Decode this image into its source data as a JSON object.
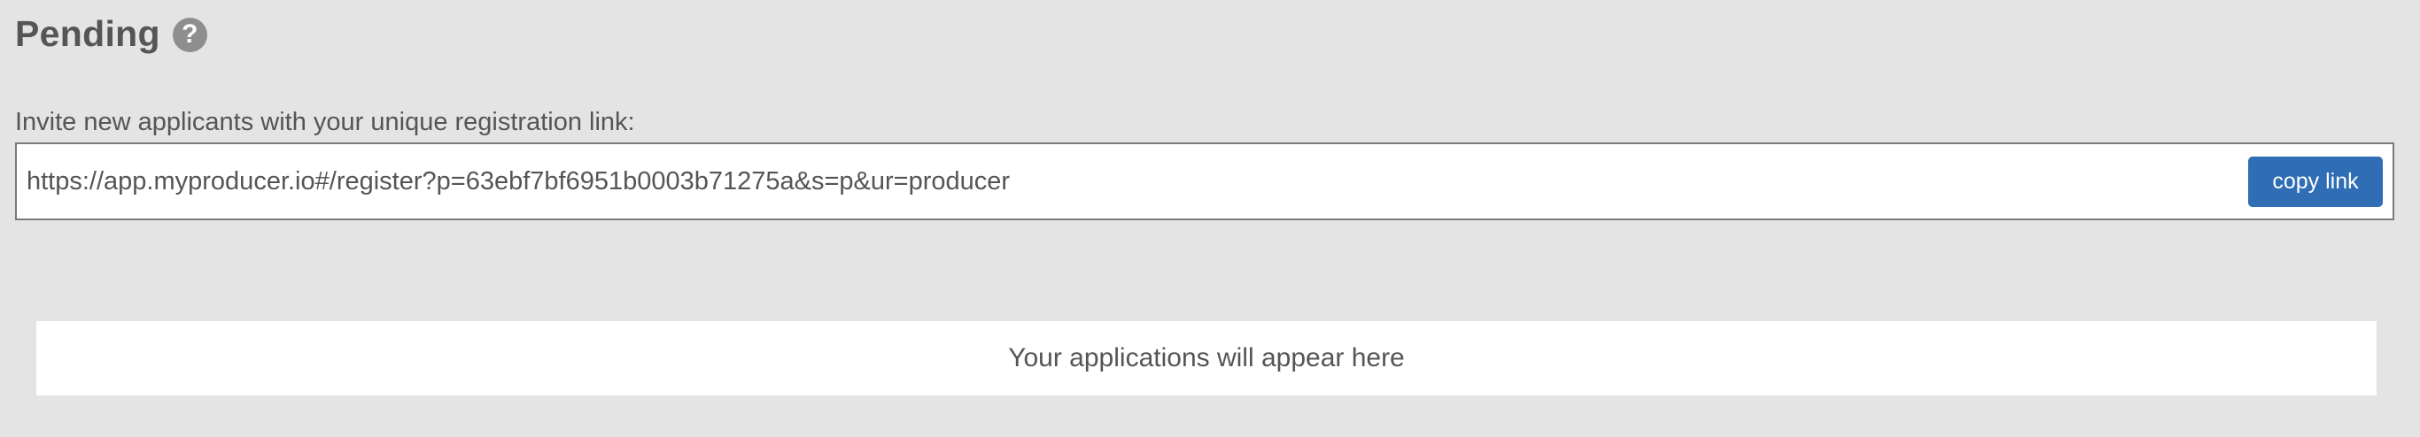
{
  "header": {
    "title": "Pending",
    "help_icon": "question-circle-icon",
    "help_glyph": "?"
  },
  "invite": {
    "label": "Invite new applicants with your unique registration link:",
    "link_value": "https://app.myproducer.io#/register?p=63ebf7bf6951b0003b71275a&s=p&ur=producer",
    "copy_button_label": "copy link"
  },
  "applications": {
    "empty_message": "Your applications will appear here"
  },
  "colors": {
    "background": "#e4e4e4",
    "accent": "#2f6db5",
    "text": "#555555",
    "help_icon": "#8e8e8e"
  }
}
